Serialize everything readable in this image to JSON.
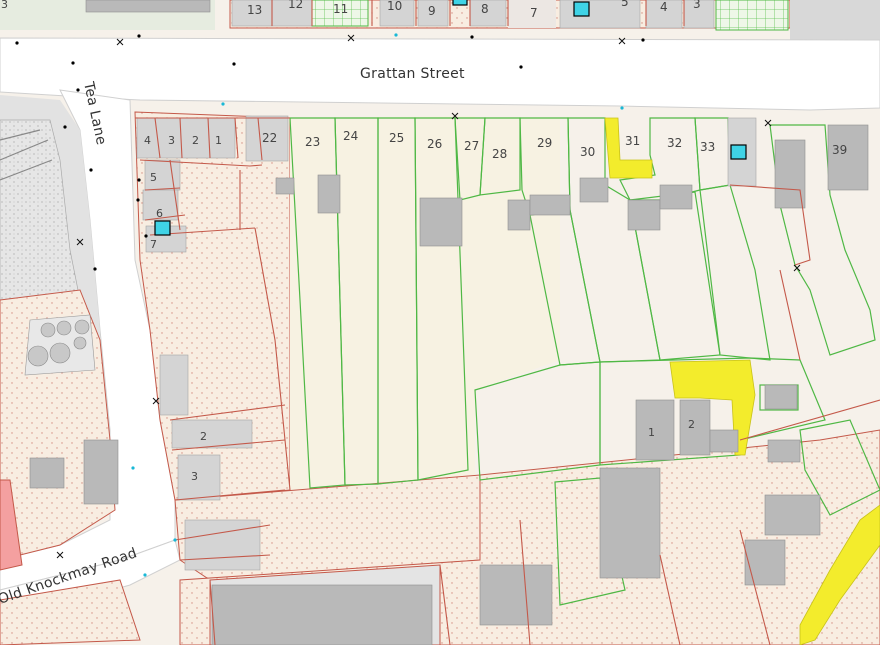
{
  "map": {
    "colors": {
      "road_fill": "#ffffff",
      "road_casing": "#d2d2d2",
      "plot_fill": "#f7ecdf",
      "plot_outline": "#c4594a",
      "plot_stipple": "#d48c80",
      "green_hatch": "#4fb845",
      "green_fill": "#e8f4e0",
      "highlight": "#f3ec2c",
      "building": "#b9b9b9",
      "building_light": "#d4d4d4",
      "marker": "#3fd3e6",
      "pink_plot": "#f4a0a0",
      "grey_area": "#d6d6d6"
    },
    "roads": {
      "grattan_street": "Grattan Street",
      "tea_lane": "Tea Lane",
      "old_knockmay_road": "Old Knockmay Road"
    },
    "house_numbers": {
      "top_row": [
        "13",
        "12",
        "11",
        "10",
        "9",
        "8",
        "7",
        "5",
        "4",
        "3"
      ],
      "tea_lane_corner": [
        "4",
        "3",
        "2",
        "1",
        "22"
      ],
      "tea_lane_side": [
        "5",
        "6",
        "7",
        "2",
        "3"
      ],
      "grattan_south": [
        "23",
        "24",
        "25",
        "26",
        "27",
        "28",
        "29",
        "30",
        "31",
        "32",
        "33",
        "39"
      ],
      "inner": [
        "1",
        "2"
      ],
      "edge": [
        "3"
      ]
    },
    "markers": [
      "info-marker",
      "info-marker",
      "info-marker",
      "info-marker",
      "info-marker"
    ]
  }
}
